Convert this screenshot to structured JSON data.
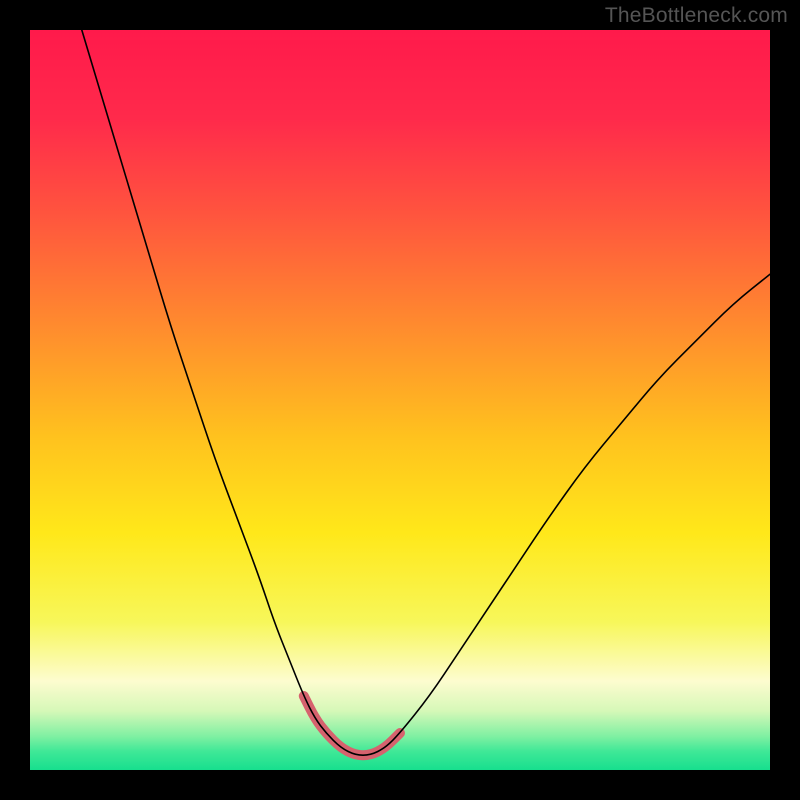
{
  "watermark": "TheBottleneck.com",
  "chart_data": {
    "type": "line",
    "title": "",
    "xlabel": "",
    "ylabel": "",
    "xlim": [
      0,
      100
    ],
    "ylim": [
      0,
      100
    ],
    "grid": false,
    "series": [
      {
        "name": "main-curve",
        "x": [
          7,
          10,
          13,
          16,
          19,
          22,
          25,
          28,
          31,
          33,
          35,
          37,
          38.5,
          40,
          42,
          44,
          46,
          48,
          50,
          54,
          58,
          62,
          66,
          70,
          75,
          80,
          85,
          90,
          95,
          100
        ],
        "y": [
          100,
          90,
          80,
          70,
          60,
          51,
          42,
          34,
          26,
          20,
          15,
          10,
          7,
          5,
          3,
          2,
          2,
          3,
          5,
          10,
          16,
          22,
          28,
          34,
          41,
          47,
          53,
          58,
          63,
          67
        ],
        "stroke": "#000000",
        "width": 1.6
      },
      {
        "name": "highlight-curve",
        "x": [
          37,
          38.5,
          40,
          42,
          44,
          46,
          48,
          50
        ],
        "y": [
          10,
          7,
          5,
          3,
          2,
          2,
          3,
          5
        ],
        "stroke": "#d6626e",
        "width": 10
      }
    ],
    "background_gradient_stops": [
      {
        "offset": 0.0,
        "color": "#ff1a4b"
      },
      {
        "offset": 0.12,
        "color": "#ff2a4b"
      },
      {
        "offset": 0.25,
        "color": "#ff553e"
      },
      {
        "offset": 0.4,
        "color": "#ff8b2e"
      },
      {
        "offset": 0.55,
        "color": "#ffc21e"
      },
      {
        "offset": 0.68,
        "color": "#ffe81a"
      },
      {
        "offset": 0.8,
        "color": "#f7f75a"
      },
      {
        "offset": 0.88,
        "color": "#fdfccf"
      },
      {
        "offset": 0.92,
        "color": "#d6f8b8"
      },
      {
        "offset": 0.955,
        "color": "#7ef0a2"
      },
      {
        "offset": 0.975,
        "color": "#3fe897"
      },
      {
        "offset": 1.0,
        "color": "#17df8e"
      }
    ]
  }
}
